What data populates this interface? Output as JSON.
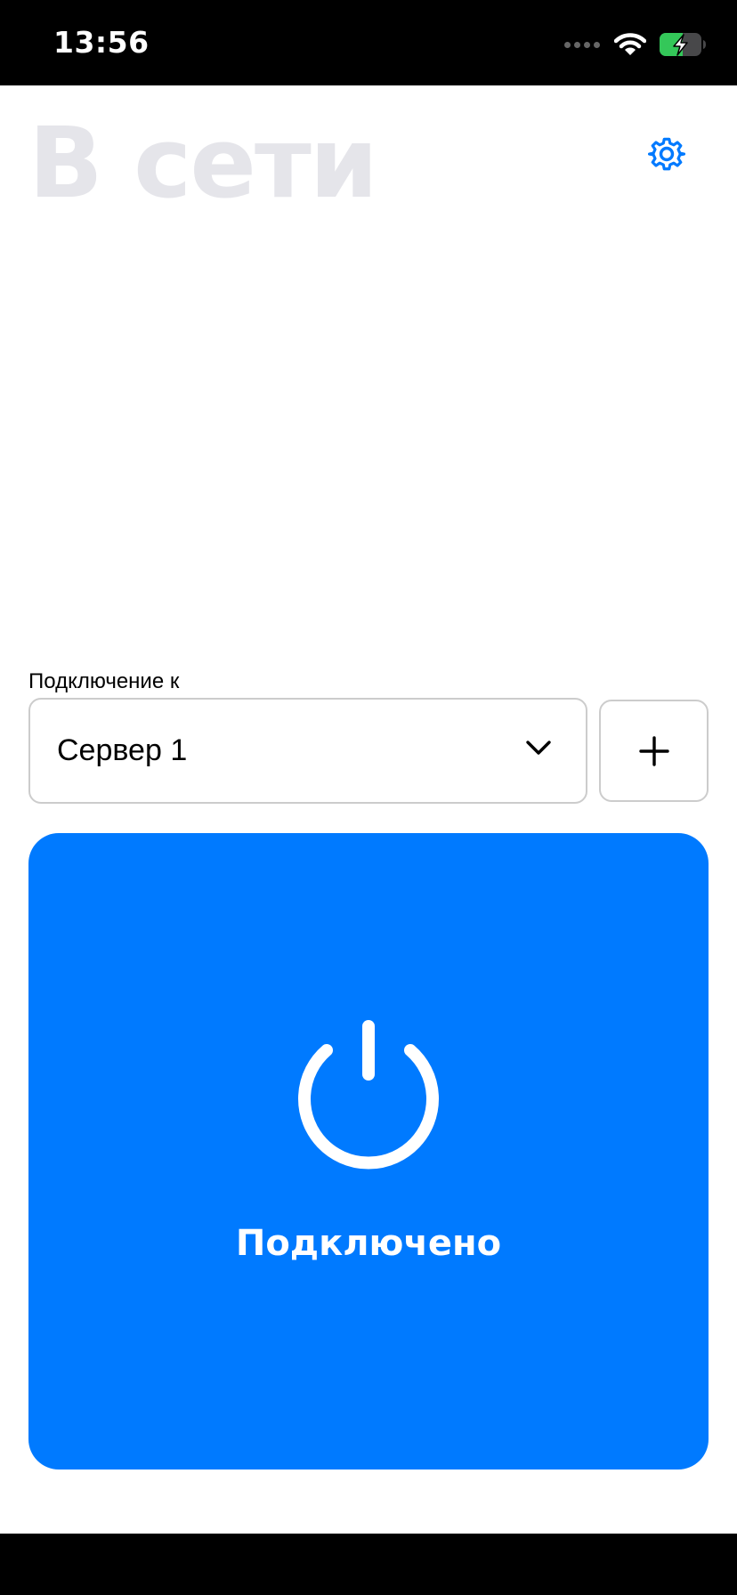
{
  "status_bar": {
    "time": "13:56",
    "icons": [
      "signal-dots-icon",
      "wifi-icon",
      "battery-charging-icon"
    ]
  },
  "header": {
    "title": "В сети",
    "settings_icon": "gear-icon"
  },
  "connection": {
    "label": "Подключение к",
    "selected_server": "Сервер 1",
    "dropdown_icon": "chevron-down-icon",
    "add_icon": "plus-icon"
  },
  "power_card": {
    "icon": "power-icon",
    "status": "Подключено"
  },
  "colors": {
    "accent": "#007AFF",
    "title": "#E5E5EA",
    "border": "#CCCCCC",
    "battery": "#34C759"
  }
}
